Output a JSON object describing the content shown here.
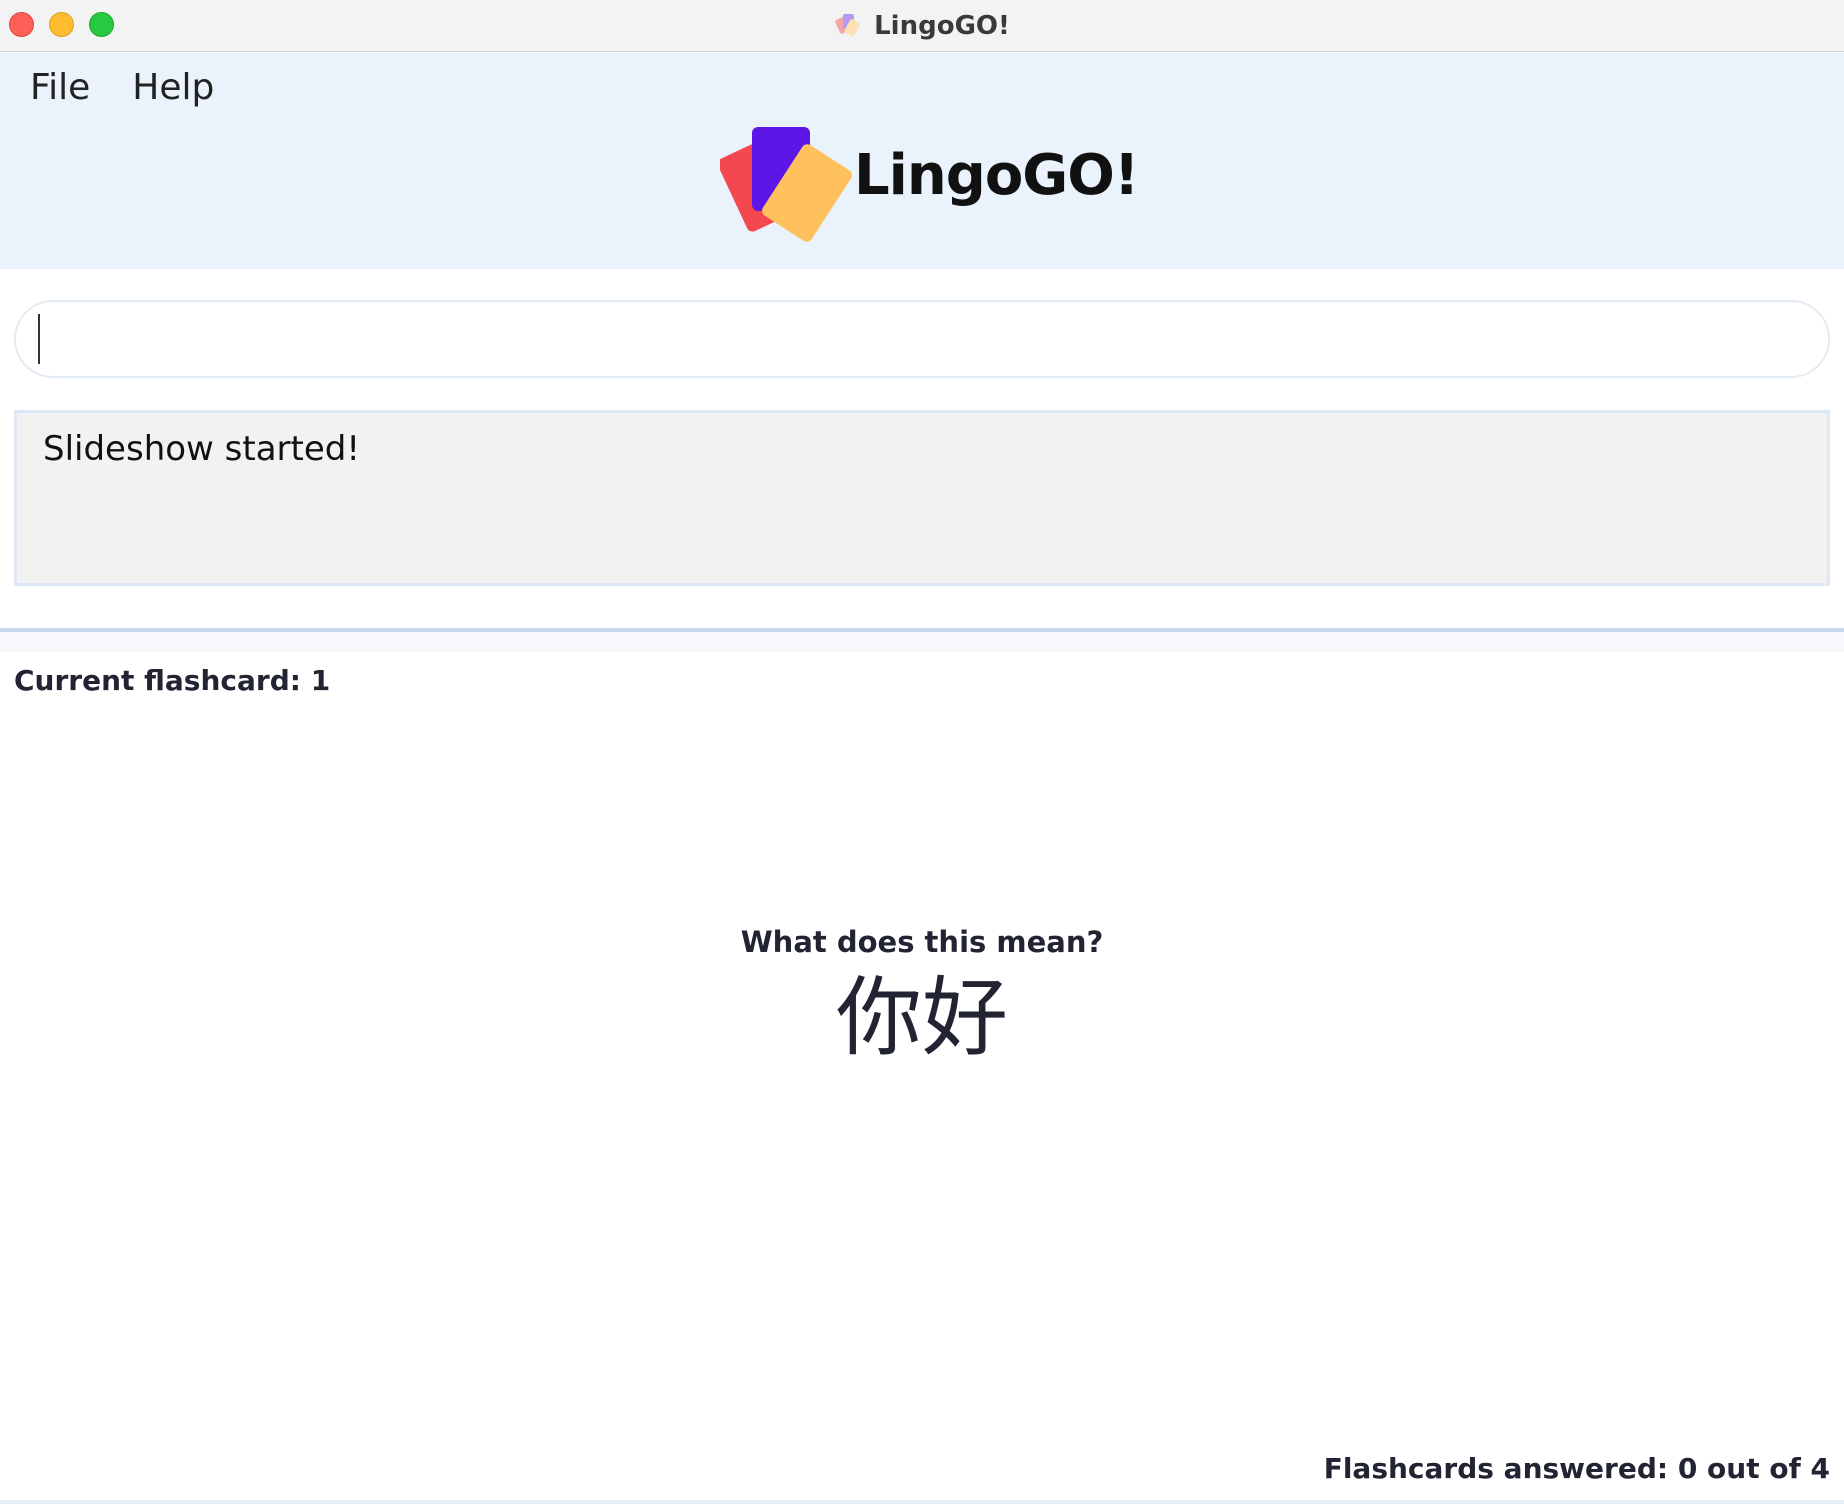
{
  "window": {
    "title": "LingoGO!",
    "app_icon": "lingogo-cards-icon"
  },
  "menu": {
    "items": [
      {
        "label": "File"
      },
      {
        "label": "Help"
      }
    ]
  },
  "logo": {
    "text": "LingoGO!",
    "card_colors": [
      "#f4474f",
      "#5c16e5",
      "#ffc15e"
    ]
  },
  "command": {
    "value": "",
    "placeholder": ""
  },
  "result": {
    "message": "Slideshow started!"
  },
  "flashcard": {
    "current_label": "Current flashcard: 1",
    "prompt": "What does this mean?",
    "word": "你好",
    "answered_label": "Flashcards answered: 0 out of 4"
  },
  "colors": {
    "header_bg": "#eaf2fc",
    "result_bg": "#f2f2f2",
    "text_dark": "#222433"
  }
}
